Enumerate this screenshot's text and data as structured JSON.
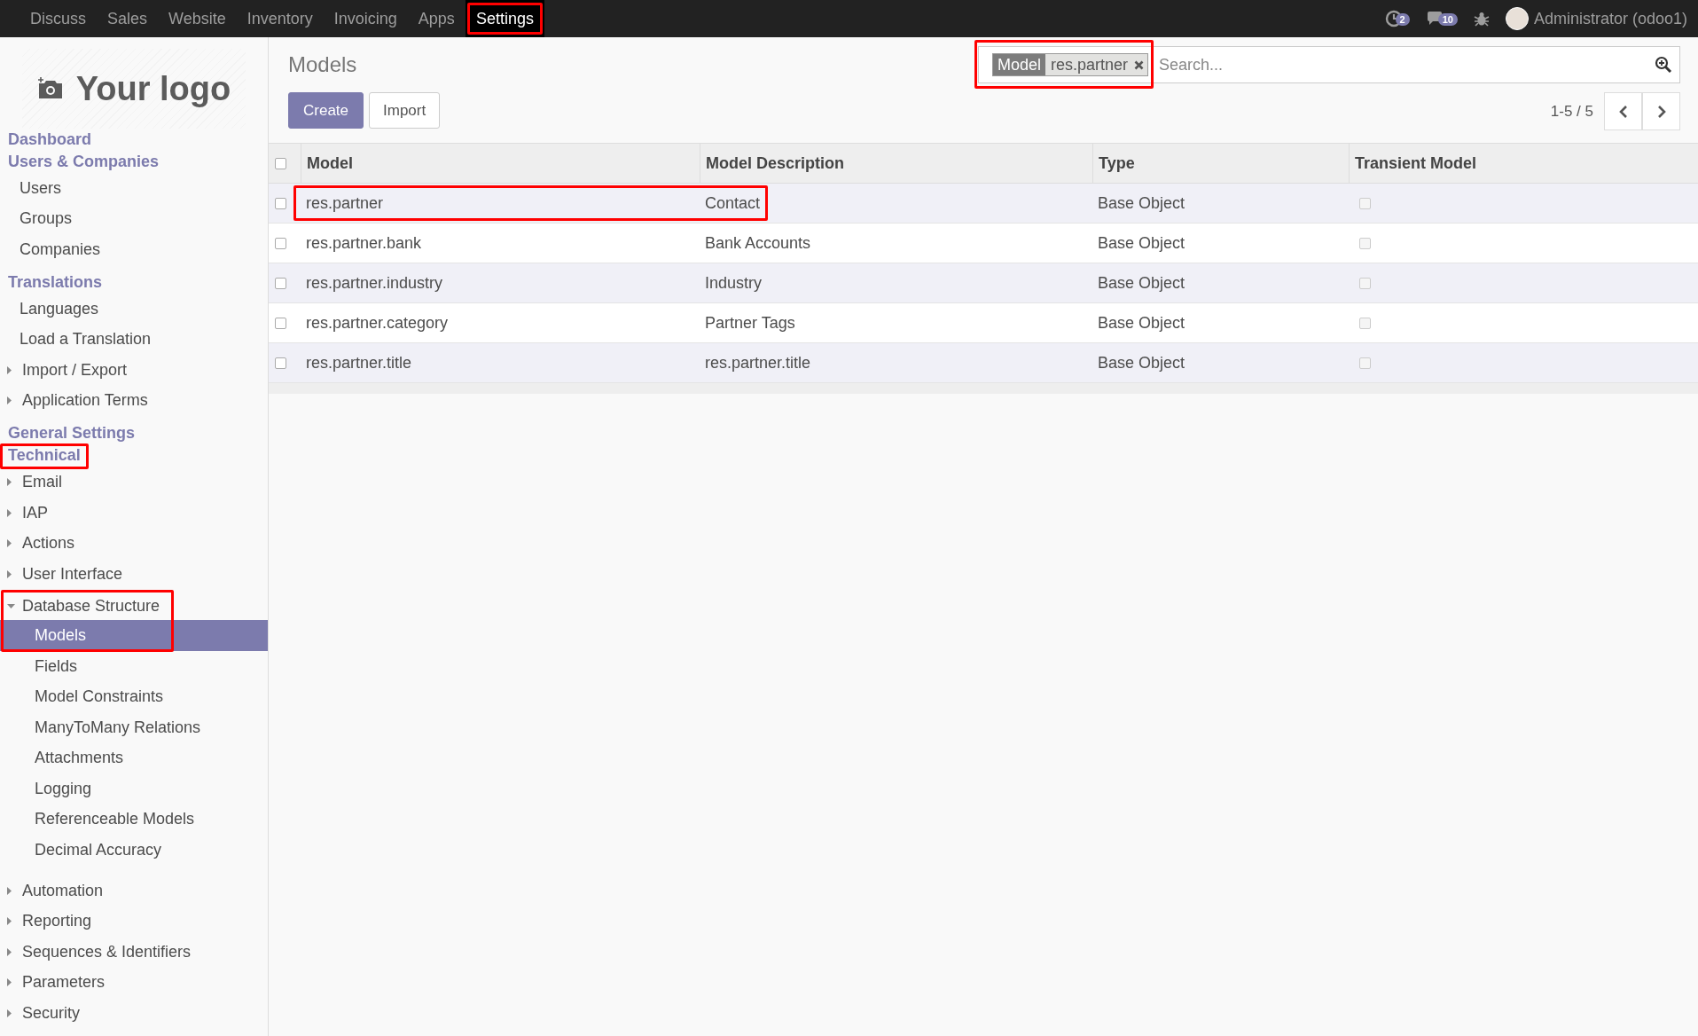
{
  "top_menu": [
    {
      "label": "Discuss",
      "selected": false,
      "annotated": false
    },
    {
      "label": "Sales",
      "selected": false,
      "annotated": false
    },
    {
      "label": "Website",
      "selected": false,
      "annotated": false
    },
    {
      "label": "Inventory",
      "selected": false,
      "annotated": false
    },
    {
      "label": "Invoicing",
      "selected": false,
      "annotated": false
    },
    {
      "label": "Apps",
      "selected": false,
      "annotated": false
    },
    {
      "label": "Settings",
      "selected": true,
      "annotated": true
    }
  ],
  "systray": {
    "activities_count": "2",
    "messages_count": "10",
    "user": "Administrator (odoo1)"
  },
  "logo": {
    "text": "Your logo"
  },
  "sidebar": [
    {
      "label": "Dashboard",
      "annotated": false
    },
    {
      "label": "Users & Companies",
      "annotated": false,
      "items": [
        {
          "label": "Users",
          "kind": "leaf",
          "selected": false,
          "annotated": false
        },
        {
          "label": "Groups",
          "kind": "leaf",
          "selected": false,
          "annotated": false
        },
        {
          "label": "Companies",
          "kind": "leaf",
          "selected": false,
          "annotated": false
        }
      ]
    },
    {
      "label": "Translations",
      "annotated": false,
      "items": [
        {
          "label": "Languages",
          "kind": "leaf",
          "selected": false,
          "annotated": false
        },
        {
          "label": "Load a Translation",
          "kind": "leaf",
          "selected": false,
          "annotated": false
        },
        {
          "label": "Import / Export",
          "kind": "folder",
          "expanded": false,
          "selected": false,
          "annotated": false
        },
        {
          "label": "Application Terms",
          "kind": "folder",
          "expanded": false,
          "selected": false,
          "annotated": false
        }
      ]
    },
    {
      "label": "General Settings",
      "annotated": false
    },
    {
      "label": "Technical",
      "annotated": true,
      "items": [
        {
          "label": "Email",
          "kind": "folder",
          "expanded": false,
          "selected": false,
          "annotated": false
        },
        {
          "label": "IAP",
          "kind": "folder",
          "expanded": false,
          "selected": false,
          "annotated": false
        },
        {
          "label": "Actions",
          "kind": "folder",
          "expanded": false,
          "selected": false,
          "annotated": false
        },
        {
          "label": "User Interface",
          "kind": "folder",
          "expanded": false,
          "selected": false,
          "annotated": false
        },
        {
          "label": "Database Structure",
          "kind": "folder",
          "expanded": true,
          "selected": false,
          "annotated": true,
          "children": [
            {
              "label": "Models",
              "selected": true
            },
            {
              "label": "Fields",
              "selected": false
            },
            {
              "label": "Model Constraints",
              "selected": false
            },
            {
              "label": "ManyToMany Relations",
              "selected": false
            },
            {
              "label": "Attachments",
              "selected": false
            },
            {
              "label": "Logging",
              "selected": false
            },
            {
              "label": "Referenceable Models",
              "selected": false
            },
            {
              "label": "Decimal Accuracy",
              "selected": false
            }
          ]
        },
        {
          "label": "Automation",
          "kind": "folder",
          "expanded": false,
          "selected": false,
          "annotated": false
        },
        {
          "label": "Reporting",
          "kind": "folder",
          "expanded": false,
          "selected": false,
          "annotated": false
        },
        {
          "label": "Sequences & Identifiers",
          "kind": "folder",
          "expanded": false,
          "selected": false,
          "annotated": false
        },
        {
          "label": "Parameters",
          "kind": "folder",
          "expanded": false,
          "selected": false,
          "annotated": false
        },
        {
          "label": "Security",
          "kind": "folder",
          "expanded": false,
          "selected": false,
          "annotated": false
        }
      ]
    }
  ],
  "page": {
    "title": "Models",
    "buttons": [
      {
        "label": "Create",
        "kind": "primary"
      },
      {
        "label": "Import",
        "kind": "secondary"
      }
    ],
    "search": {
      "facet_label": "Model",
      "facet_value": "res.partner",
      "annotated": true,
      "placeholder": "Search..."
    },
    "pager": "1-5 / 5"
  },
  "table": {
    "all_selected": false,
    "columns": [
      "Model",
      "Model Description",
      "Type",
      "Transient Model"
    ],
    "rows": [
      {
        "cells": [
          "res.partner",
          "Contact",
          "Base Object"
        ],
        "transient": false,
        "selected": false,
        "annotated": true
      },
      {
        "cells": [
          "res.partner.bank",
          "Bank Accounts",
          "Base Object"
        ],
        "transient": false,
        "selected": false,
        "annotated": false
      },
      {
        "cells": [
          "res.partner.industry",
          "Industry",
          "Base Object"
        ],
        "transient": false,
        "selected": false,
        "annotated": false
      },
      {
        "cells": [
          "res.partner.category",
          "Partner Tags",
          "Base Object"
        ],
        "transient": false,
        "selected": false,
        "annotated": false
      },
      {
        "cells": [
          "res.partner.title",
          "res.partner.title",
          "Base Object"
        ],
        "transient": false,
        "selected": false,
        "annotated": false
      }
    ]
  }
}
